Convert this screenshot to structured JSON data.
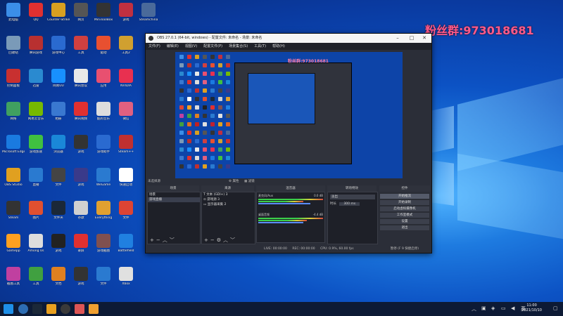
{
  "watermark": "粉丝群:973018681",
  "obs": {
    "title": "OBS 27.0.1 (64-bit, windows) - 配置文件: 未命名 - 场景: 未命名",
    "menu": [
      "文件(F)",
      "编辑(E)",
      "视图(V)",
      "配置文件(P)",
      "场景集合(S)",
      "工具(T)",
      "帮助(H)"
    ],
    "preview_watermark": "粉丝群:973018681",
    "source_label": "未选择源",
    "source_props": "属性",
    "source_filters": "滤镜",
    "panels": {
      "scenes_header": "场景",
      "scenes": [
        "场景",
        "游戏直播"
      ],
      "sources_header": "来源",
      "sources": [
        "文本 (GDI+) 3",
        "游戏源 3",
        "显示器采集 2"
      ],
      "mixer_header": "混音器",
      "mixer": [
        {
          "name": "麦克风/Aux",
          "db": "0.0 dB"
        },
        {
          "name": "桌面音频",
          "db": "-4.4 dB"
        }
      ],
      "transition_header": "转场特效",
      "transition_value": "淡出",
      "transition_duration_label": "时长",
      "transition_duration_value": "300 ms",
      "controls_header": "控件",
      "controls": [
        "开始推流",
        "开始录制",
        "启动虚拟摄像机",
        "工作室模式",
        "设置",
        "退出"
      ]
    },
    "status": {
      "live": "LIVE: 00:00:00",
      "rec": "REC: 00:00:00",
      "cpu": "CPU: 0.9%, 60.00 fps",
      "hint": "暂停 (F 9 快捷启停)"
    }
  },
  "taskbar": {
    "time": "11:00",
    "date": "2021/10/10"
  },
  "desktop_icons": [
    "此电脑",
    "QQ",
    "Counter-Strike",
    "网页",
    "MiniToolBox",
    "游戏",
    "Steamchina",
    "回收站",
    "腾讯游戏",
    "游戏中心",
    "工具",
    "驱动",
    "工具2",
    "控制面板",
    "迅雷",
    "网易UU",
    "腾讯会议",
    "应用",
    "NVIDIA",
    "网络",
    "网易云音乐",
    "相册",
    "腾讯视频",
    "酷狗音乐",
    "微信",
    "Microsoft Edge",
    "游戏加速",
    "浏览器",
    "游戏",
    "游戏助手",
    "Steam++",
    "OBS Studio",
    "直播",
    "文件",
    "游戏",
    "WeGame",
    "快速启动",
    "Steam",
    "图片",
    "文件夹",
    "谷歌",
    "Everything",
    "文件",
    "Gamepp",
    "Among Us",
    "游戏",
    "录屏",
    "游戏截图",
    "Battlefield",
    "截图工具",
    "工具",
    "文档",
    "游戏",
    "文件",
    "Xbox",
    "工具箱",
    "录像",
    "游戏",
    "游戏",
    "应用",
    "Origin"
  ]
}
